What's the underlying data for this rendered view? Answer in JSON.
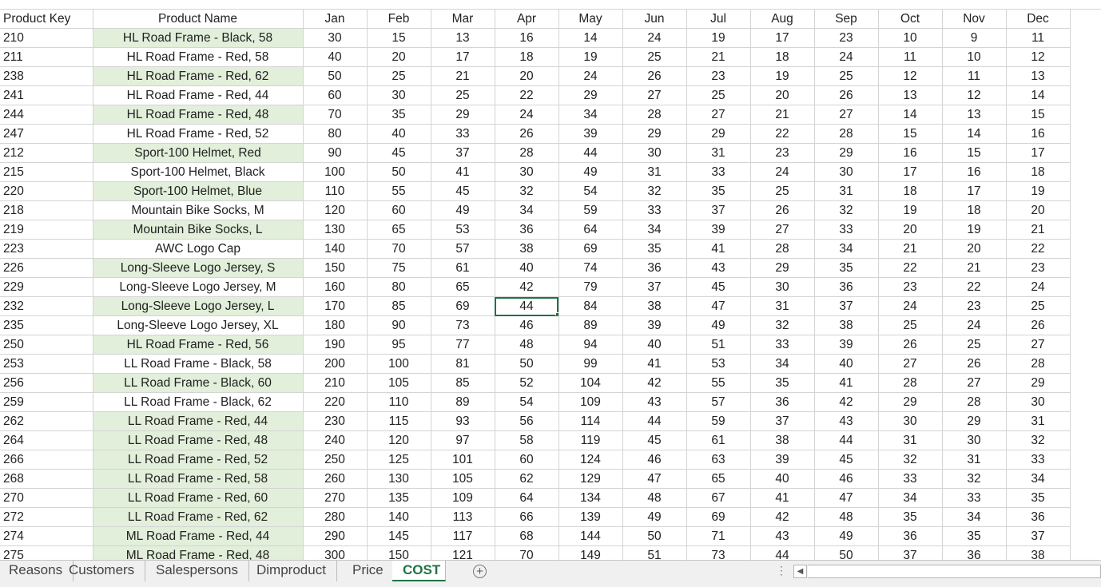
{
  "sheet": {
    "headers": [
      "Product Key",
      "Product Name",
      "Jan",
      "Feb",
      "Mar",
      "Apr",
      "May",
      "Jun",
      "Jul",
      "Aug",
      "Sep",
      "Oct",
      "Nov",
      "Dec"
    ],
    "rows": [
      [
        "210",
        "HL Road Frame - Black, 58",
        "30",
        "15",
        "13",
        "16",
        "14",
        "24",
        "19",
        "17",
        "23",
        "10",
        "9",
        "11"
      ],
      [
        "211",
        "HL Road Frame - Red, 58",
        "40",
        "20",
        "17",
        "18",
        "19",
        "25",
        "21",
        "18",
        "24",
        "11",
        "10",
        "12"
      ],
      [
        "238",
        "HL Road Frame - Red, 62",
        "50",
        "25",
        "21",
        "20",
        "24",
        "26",
        "23",
        "19",
        "25",
        "12",
        "11",
        "13"
      ],
      [
        "241",
        "HL Road Frame - Red, 44",
        "60",
        "30",
        "25",
        "22",
        "29",
        "27",
        "25",
        "20",
        "26",
        "13",
        "12",
        "14"
      ],
      [
        "244",
        "HL Road Frame - Red, 48",
        "70",
        "35",
        "29",
        "24",
        "34",
        "28",
        "27",
        "21",
        "27",
        "14",
        "13",
        "15"
      ],
      [
        "247",
        "HL Road Frame - Red, 52",
        "80",
        "40",
        "33",
        "26",
        "39",
        "29",
        "29",
        "22",
        "28",
        "15",
        "14",
        "16"
      ],
      [
        "212",
        "Sport-100 Helmet, Red",
        "90",
        "45",
        "37",
        "28",
        "44",
        "30",
        "31",
        "23",
        "29",
        "16",
        "15",
        "17"
      ],
      [
        "215",
        "Sport-100 Helmet, Black",
        "100",
        "50",
        "41",
        "30",
        "49",
        "31",
        "33",
        "24",
        "30",
        "17",
        "16",
        "18"
      ],
      [
        "220",
        "Sport-100 Helmet, Blue",
        "110",
        "55",
        "45",
        "32",
        "54",
        "32",
        "35",
        "25",
        "31",
        "18",
        "17",
        "19"
      ],
      [
        "218",
        "Mountain Bike Socks, M",
        "120",
        "60",
        "49",
        "34",
        "59",
        "33",
        "37",
        "26",
        "32",
        "19",
        "18",
        "20"
      ],
      [
        "219",
        "Mountain Bike Socks, L",
        "130",
        "65",
        "53",
        "36",
        "64",
        "34",
        "39",
        "27",
        "33",
        "20",
        "19",
        "21"
      ],
      [
        "223",
        "AWC Logo Cap",
        "140",
        "70",
        "57",
        "38",
        "69",
        "35",
        "41",
        "28",
        "34",
        "21",
        "20",
        "22"
      ],
      [
        "226",
        "Long-Sleeve Logo Jersey, S",
        "150",
        "75",
        "61",
        "40",
        "74",
        "36",
        "43",
        "29",
        "35",
        "22",
        "21",
        "23"
      ],
      [
        "229",
        "Long-Sleeve Logo Jersey, M",
        "160",
        "80",
        "65",
        "42",
        "79",
        "37",
        "45",
        "30",
        "36",
        "23",
        "22",
        "24"
      ],
      [
        "232",
        "Long-Sleeve Logo Jersey, L",
        "170",
        "85",
        "69",
        "44",
        "84",
        "38",
        "47",
        "31",
        "37",
        "24",
        "23",
        "25"
      ],
      [
        "235",
        "Long-Sleeve Logo Jersey, XL",
        "180",
        "90",
        "73",
        "46",
        "89",
        "39",
        "49",
        "32",
        "38",
        "25",
        "24",
        "26"
      ],
      [
        "250",
        "HL Road Frame - Red, 56",
        "190",
        "95",
        "77",
        "48",
        "94",
        "40",
        "51",
        "33",
        "39",
        "26",
        "25",
        "27"
      ],
      [
        "253",
        "LL Road Frame - Black, 58",
        "200",
        "100",
        "81",
        "50",
        "99",
        "41",
        "53",
        "34",
        "40",
        "27",
        "26",
        "28"
      ],
      [
        "256",
        "LL Road Frame - Black, 60",
        "210",
        "105",
        "85",
        "52",
        "104",
        "42",
        "55",
        "35",
        "41",
        "28",
        "27",
        "29"
      ],
      [
        "259",
        "LL Road Frame - Black, 62",
        "220",
        "110",
        "89",
        "54",
        "109",
        "43",
        "57",
        "36",
        "42",
        "29",
        "28",
        "30"
      ],
      [
        "262",
        "LL Road Frame - Red, 44",
        "230",
        "115",
        "93",
        "56",
        "114",
        "44",
        "59",
        "37",
        "43",
        "30",
        "29",
        "31"
      ],
      [
        "264",
        "LL Road Frame - Red, 48",
        "240",
        "120",
        "97",
        "58",
        "119",
        "45",
        "61",
        "38",
        "44",
        "31",
        "30",
        "32"
      ],
      [
        "266",
        "LL Road Frame - Red, 52",
        "250",
        "125",
        "101",
        "60",
        "124",
        "46",
        "63",
        "39",
        "45",
        "32",
        "31",
        "33"
      ],
      [
        "268",
        "LL Road Frame - Red, 58",
        "260",
        "130",
        "105",
        "62",
        "129",
        "47",
        "65",
        "40",
        "46",
        "33",
        "32",
        "34"
      ],
      [
        "270",
        "LL Road Frame - Red, 60",
        "270",
        "135",
        "109",
        "64",
        "134",
        "48",
        "67",
        "41",
        "47",
        "34",
        "33",
        "35"
      ],
      [
        "272",
        "LL Road Frame - Red, 62",
        "280",
        "140",
        "113",
        "66",
        "139",
        "49",
        "69",
        "42",
        "48",
        "35",
        "34",
        "36"
      ],
      [
        "274",
        "ML Road Frame - Red, 44",
        "290",
        "145",
        "117",
        "68",
        "144",
        "50",
        "71",
        "43",
        "49",
        "36",
        "35",
        "37"
      ],
      [
        "275",
        "ML Road Frame - Red, 48",
        "300",
        "150",
        "121",
        "70",
        "149",
        "51",
        "73",
        "44",
        "50",
        "37",
        "36",
        "38"
      ]
    ],
    "shaded_rows": [
      0,
      2,
      4,
      6,
      8,
      10,
      12,
      14,
      16,
      18,
      20,
      21,
      22,
      23,
      24,
      25,
      26,
      27
    ],
    "selected_cell": {
      "row": 14,
      "col": 5
    },
    "shade_color": "#e2efda",
    "selection_color": "#217346"
  },
  "tabs": [
    "Reasons",
    "Customers",
    "Salespersons",
    "Dimproduct",
    "Price",
    "COST"
  ],
  "active_tab": "COST",
  "add_sheet_symbol": "+",
  "scroll_left_symbol": "◀",
  "dots_symbol": "⋮"
}
